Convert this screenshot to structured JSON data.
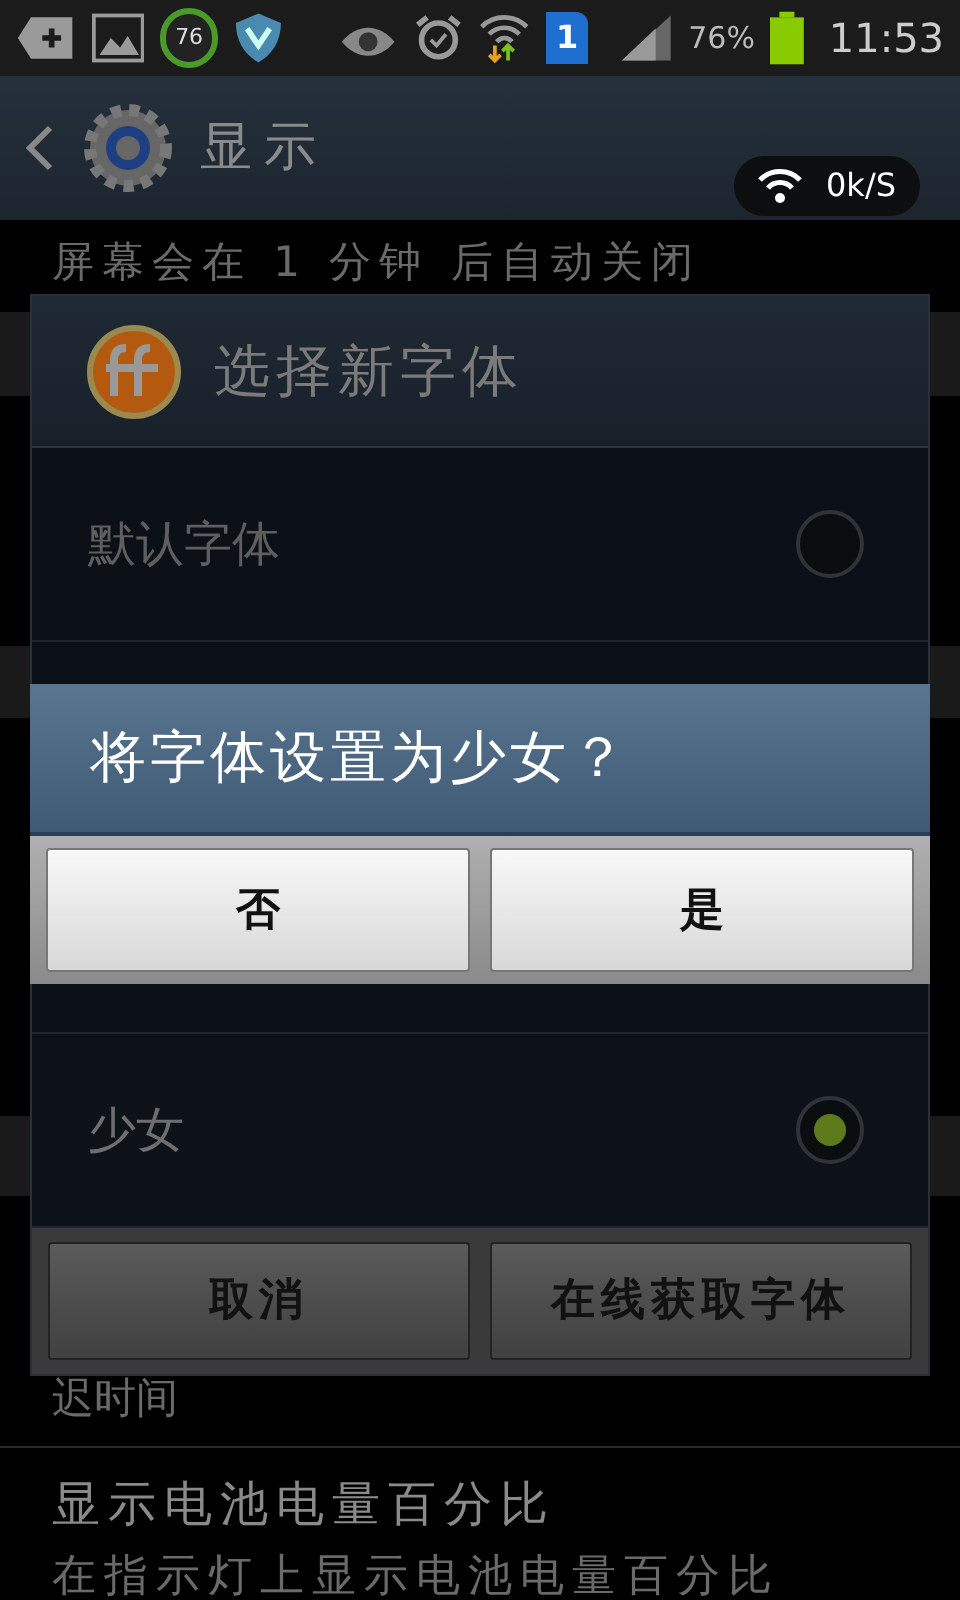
{
  "status_bar": {
    "ring_badge": "76",
    "sim_badge": "1",
    "battery_text": "76%",
    "time": "11:53"
  },
  "action_bar": {
    "title": "显示"
  },
  "speed_badge": {
    "text": "0k/S"
  },
  "background_list": {
    "top_text": "屏幕会在 1 分钟 后自动关闭",
    "lines": [
      "迟时间",
      "显示电池电量百分比",
      "在指示灯上显示电池电量百分比"
    ]
  },
  "font_dialog": {
    "title": "选择新字体",
    "options": [
      {
        "label": "默认字体",
        "selected": false
      },
      {
        "label": "少女",
        "selected": true
      }
    ],
    "buttons": [
      "取消",
      "在线获取字体"
    ]
  },
  "confirm_dialog": {
    "message": "将字体设置为少女？",
    "buttons": [
      "否",
      "是"
    ]
  }
}
